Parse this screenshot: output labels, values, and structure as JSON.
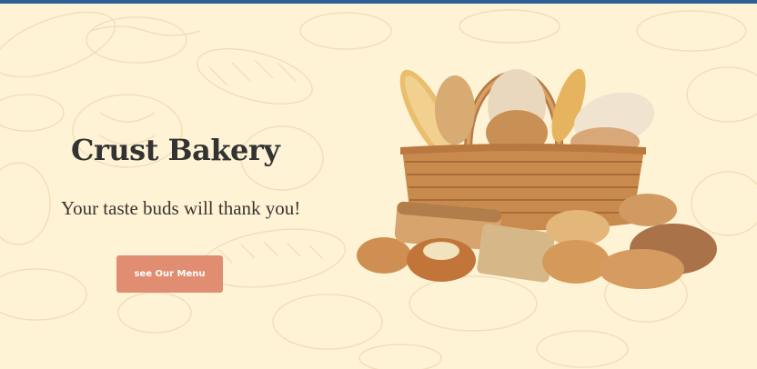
{
  "hero": {
    "title": "Crust Bakery",
    "tagline": "Your taste buds will thank you!",
    "cta_label": "see Our Menu"
  },
  "colors": {
    "background": "#fff3d6",
    "top_bar": "#2f5f95",
    "cta": "#e08d72",
    "title_text": "#333333"
  },
  "icons": {
    "hero_image": "bread-basket-image",
    "background": "bread-sketch-pattern"
  }
}
